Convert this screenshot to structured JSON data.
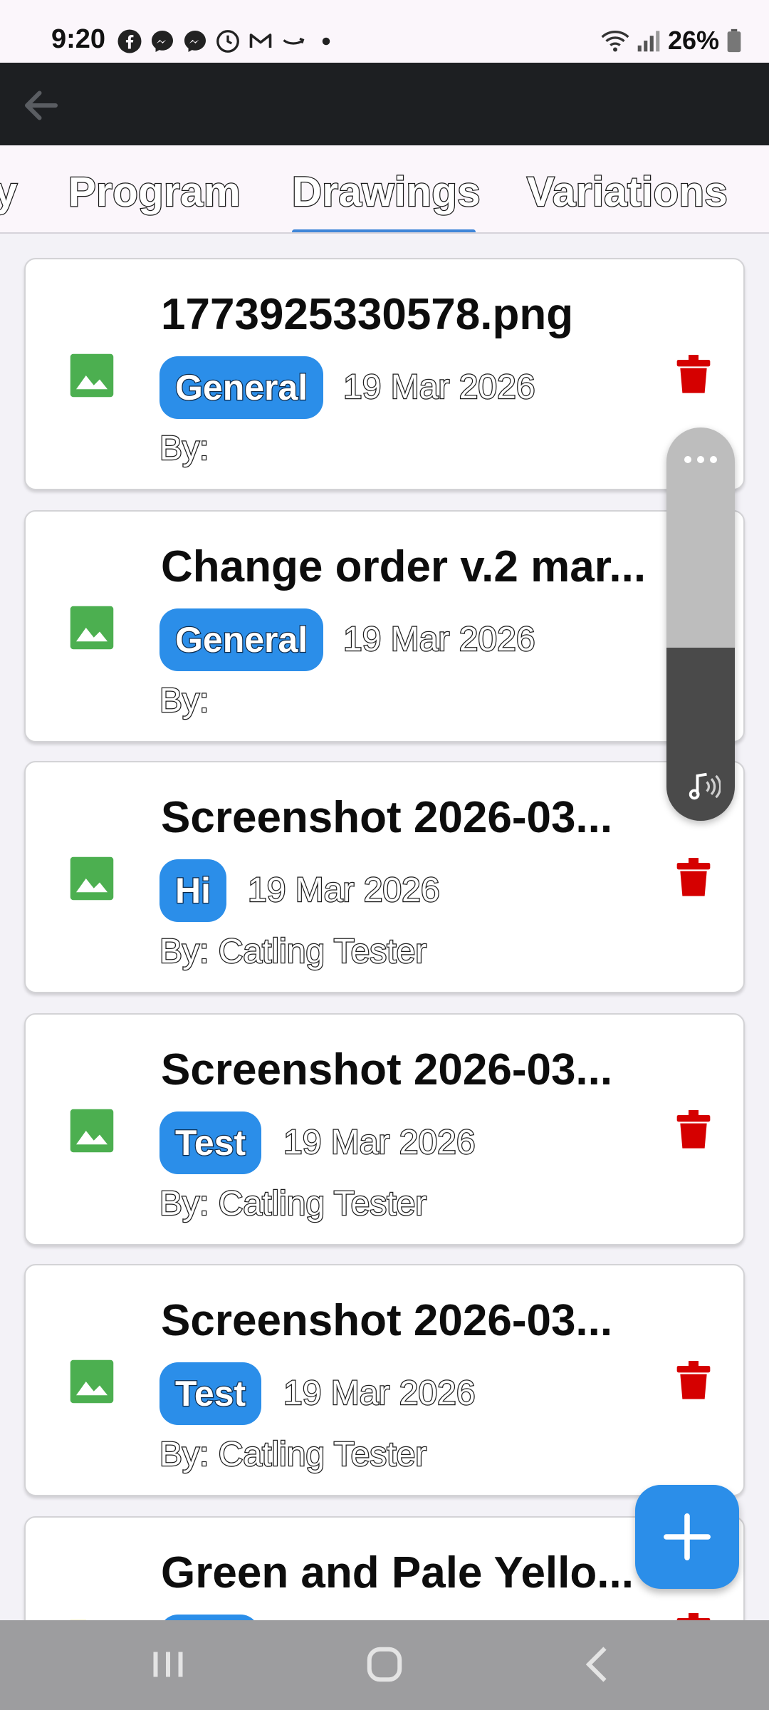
{
  "status_bar": {
    "time": "9:20",
    "battery": "26%",
    "notification_icons": [
      "facebook-icon",
      "messenger-icon",
      "messenger-icon",
      "clock-icon",
      "gmail-icon",
      "amazon-icon",
      "dot-icon"
    ]
  },
  "tabs": {
    "items": [
      {
        "label": "y",
        "selected": false
      },
      {
        "label": "Program",
        "selected": false
      },
      {
        "label": "Drawings",
        "selected": true
      },
      {
        "label": "Variations",
        "selected": false
      }
    ]
  },
  "documents": [
    {
      "title": "1773925330578.png",
      "tag": "General",
      "date": "19 Mar 2026",
      "by": "By:",
      "icon": "image-icon"
    },
    {
      "title": "Change order v.2 mar...",
      "tag": "General",
      "date": "19 Mar 2026",
      "by": "By:",
      "icon": "image-icon"
    },
    {
      "title": "Screenshot 2026-03...",
      "tag": "Hi",
      "date": "19 Mar 2026",
      "by": "By: Catling Tester",
      "icon": "image-icon"
    },
    {
      "title": "Screenshot 2026-03...",
      "tag": "Test",
      "date": "19 Mar 2026",
      "by": "By: Catling Tester",
      "icon": "image-icon"
    },
    {
      "title": "Screenshot 2026-03...",
      "tag": "Test",
      "date": "19 Mar 2026",
      "by": "By: Catling Tester",
      "icon": "image-icon"
    },
    {
      "title": "Green and Pale Yello...",
      "tag": "",
      "date": "",
      "by": "",
      "icon": "folder-icon"
    }
  ],
  "volume": {
    "level_percent": 44,
    "icon": "media-volume-icon"
  },
  "colors": {
    "accent": "#2b8ee9",
    "image_icon": "#4caf50",
    "delete": "#d50000",
    "app_bar": "#1d1f22"
  }
}
